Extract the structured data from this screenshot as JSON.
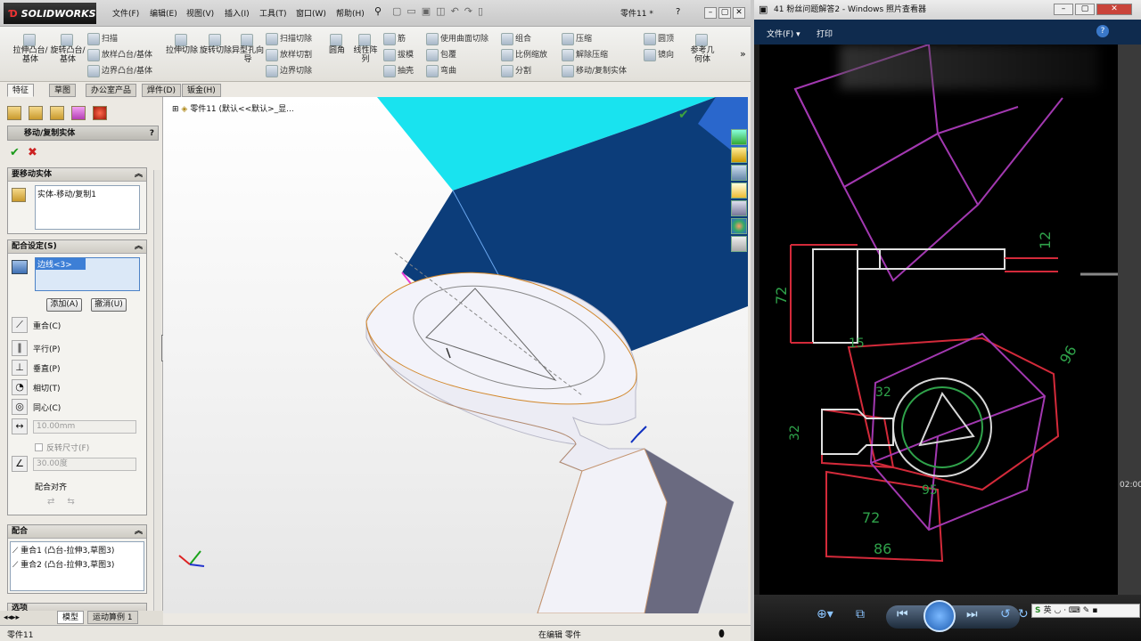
{
  "solidworks": {
    "logo": "SOLIDWORKS",
    "menu": [
      "文件(F)",
      "编辑(E)",
      "视图(V)",
      "插入(I)",
      "工具(T)",
      "窗口(W)",
      "帮助(H)"
    ],
    "document_name": "零件11 *",
    "ribbon": {
      "big_buttons": [
        "拉伸凸台/基体",
        "旋转凸台/基体",
        "拉伸切除",
        "旋转切除",
        "异型孔向导",
        "圆角",
        "线性阵列",
        "参考几何体"
      ],
      "small_buttons": [
        "扫描",
        "放样凸台/基体",
        "边界凸台/基体",
        "扫描切除",
        "放样切割",
        "边界切除",
        "筋",
        "拔模",
        "抽壳",
        "使用曲面切除",
        "包覆",
        "弯曲",
        "组合",
        "比例缩放",
        "分割",
        "压缩",
        "解除压缩",
        "移动/复制实体",
        "圆顶",
        "镜向"
      ]
    },
    "tabs": [
      "特征",
      "草图",
      "办公室产品",
      "焊件(D)",
      "钣金(H)"
    ],
    "property_manager": {
      "title": "移动/复制实体",
      "help": "?",
      "bodies_group": {
        "title": "要移动实体",
        "item": "实体-移动/复制1"
      },
      "mate_settings_group": {
        "title": "配合设定(S)",
        "selection": "边线<3>",
        "add_button": "添加(A)",
        "undo_button": "撤消(U)",
        "options": [
          "重合(C)",
          "平行(P)",
          "垂直(P)",
          "相切(T)",
          "同心(C)"
        ],
        "distance": "10.00mm",
        "flip": "反转尺寸(F)",
        "angle": "30.00度",
        "align": "配合对齐"
      },
      "mates_group": {
        "title": "配合",
        "items": [
          "重合1 (凸台-拉伸3,草图3)",
          "重合2 (凸台-拉伸3,草图3)"
        ]
      },
      "options_group_title": "选项"
    },
    "tree_label": "零件11 (默认<<默认>_显...",
    "bottom_tabs": [
      "模型",
      "运动算例 1"
    ],
    "status": {
      "left": "零件11",
      "middle": "在编辑 零件"
    }
  },
  "photo_viewer": {
    "title": "41 粉丝问题解答2 - Windows 照片查看器",
    "menu": [
      "文件(F)",
      "打印"
    ],
    "dims": [
      "12",
      "72",
      "32",
      "15",
      "32",
      "72",
      "86",
      "96",
      "95"
    ],
    "time": "02:00",
    "ime": "英"
  },
  "colors": {
    "accent": "#2a6ab0",
    "face_dark": "#0c3d7a",
    "face_cyan": "#19e3ef",
    "ok": "#1a9a1a",
    "cancel": "#cc2222"
  }
}
